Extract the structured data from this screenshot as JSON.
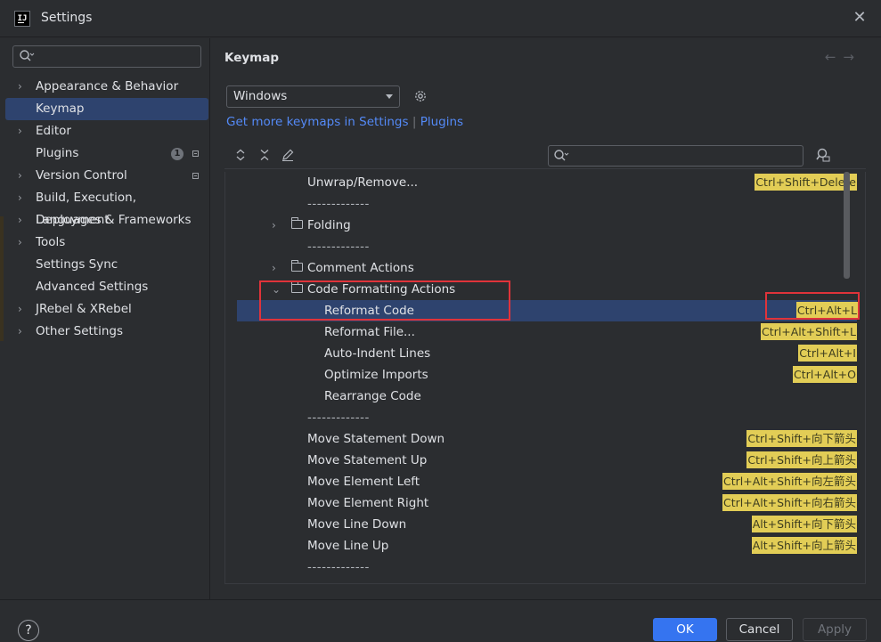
{
  "window": {
    "title": "Settings",
    "logo_text": "IJ",
    "close_glyph": "✕"
  },
  "sidebar": {
    "search_placeholder": "",
    "items": [
      {
        "label": "Appearance & Behavior",
        "expandable": true
      },
      {
        "label": "Keymap",
        "selected": true
      },
      {
        "label": "Editor",
        "expandable": true
      },
      {
        "label": "Plugins",
        "badge": "1"
      },
      {
        "label": "Version Control",
        "expandable": true
      },
      {
        "label": "Build, Execution, Deployment",
        "expandable": true
      },
      {
        "label": "Languages & Frameworks",
        "expandable": true
      },
      {
        "label": "Tools",
        "expandable": true
      },
      {
        "label": "Settings Sync"
      },
      {
        "label": "Advanced Settings"
      },
      {
        "label": "JRebel & XRebel",
        "expandable": true
      },
      {
        "label": "Other Settings",
        "expandable": true
      }
    ]
  },
  "content": {
    "title": "Keymap",
    "nav_back": "←",
    "nav_forward": "→",
    "keymap_value": "Windows",
    "more_link_text": "Get more keymaps in Settings",
    "more_link_sep": "|",
    "more_link_plugins": "Plugins",
    "search_placeholder": ""
  },
  "toolbar": {
    "expand_glyph": "⌃",
    "collapse_glyph": "✕",
    "edit_glyph": "✎"
  },
  "tree": {
    "rows": [
      {
        "label": "Unwrap/Remove...",
        "shortcut": "Ctrl+Shift+Delete"
      },
      {
        "label": "-------------",
        "separator": true
      },
      {
        "label": "Folding",
        "folder": true,
        "chevron": "›"
      },
      {
        "label": "-------------",
        "separator": true
      },
      {
        "label": "Comment Actions",
        "folder": true,
        "chevron": "›"
      },
      {
        "label": "Code Formatting Actions",
        "folder": true,
        "chevron": "⌄"
      },
      {
        "label": "Reformat Code",
        "shortcut": "Ctrl+Alt+L",
        "selected": true,
        "child": true
      },
      {
        "label": "Reformat File...",
        "shortcut": "Ctrl+Alt+Shift+L",
        "child": true
      },
      {
        "label": "Auto-Indent Lines",
        "shortcut": "Ctrl+Alt+I",
        "child": true
      },
      {
        "label": "Optimize Imports",
        "shortcut": "Ctrl+Alt+O",
        "child": true
      },
      {
        "label": "Rearrange Code",
        "child": true
      },
      {
        "label": "-------------",
        "separator": true
      },
      {
        "label": "Move Statement Down",
        "shortcut": "Ctrl+Shift+向下箭头"
      },
      {
        "label": "Move Statement Up",
        "shortcut": "Ctrl+Shift+向上箭头"
      },
      {
        "label": "Move Element Left",
        "shortcut": "Ctrl+Alt+Shift+向左箭头"
      },
      {
        "label": "Move Element Right",
        "shortcut": "Ctrl+Alt+Shift+向右箭头"
      },
      {
        "label": "Move Line Down",
        "shortcut": "Alt+Shift+向下箭头"
      },
      {
        "label": "Move Line Up",
        "shortcut": "Alt+Shift+向上箭头"
      },
      {
        "label": "-------------",
        "separator": true
      }
    ]
  },
  "footer": {
    "help": "?",
    "ok": "OK",
    "cancel": "Cancel",
    "apply": "Apply"
  },
  "colors": {
    "accent": "#3574f0",
    "selection": "#2e436e",
    "shortcut_bg": "#e2cd56",
    "annotation": "#e0333a",
    "link": "#548af7"
  }
}
